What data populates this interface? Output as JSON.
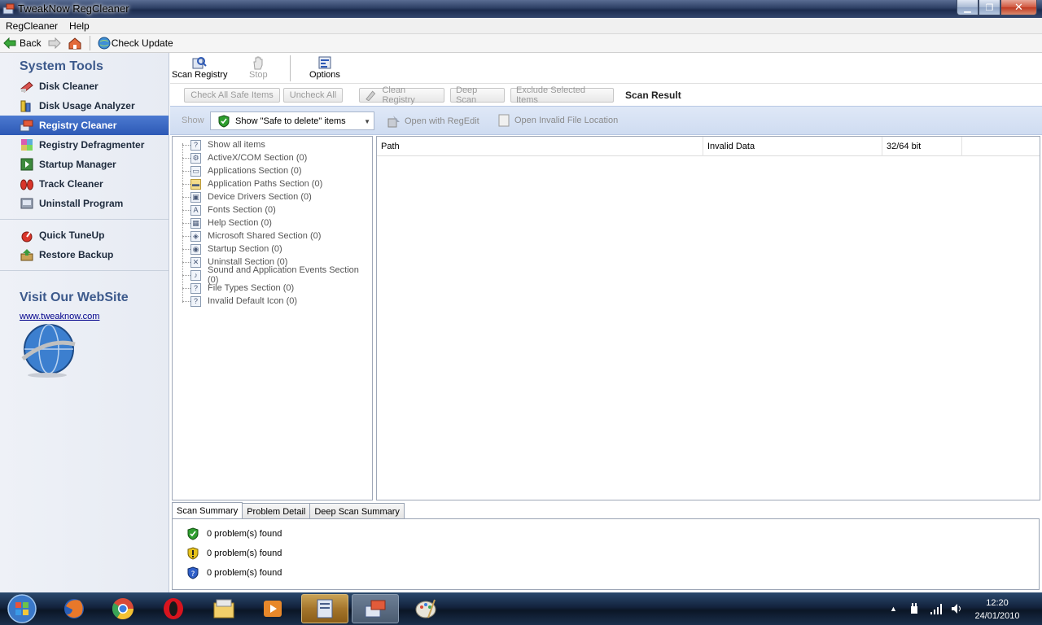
{
  "window": {
    "title": "TweakNow RegCleaner"
  },
  "menu": {
    "items": [
      "RegCleaner",
      "Help"
    ]
  },
  "nav": {
    "back": "Back",
    "check_update": "Check Update"
  },
  "sidebar": {
    "system_tools_title": "System Tools",
    "items": [
      {
        "label": "Disk Cleaner",
        "icon": "disk-cleaner-icon"
      },
      {
        "label": "Disk Usage Analyzer",
        "icon": "disk-usage-icon"
      },
      {
        "label": "Registry Cleaner",
        "icon": "registry-cleaner-icon",
        "active": true
      },
      {
        "label": "Registry Defragmenter",
        "icon": "registry-defrag-icon"
      },
      {
        "label": "Startup Manager",
        "icon": "startup-manager-icon"
      },
      {
        "label": "Track Cleaner",
        "icon": "track-cleaner-icon"
      },
      {
        "label": "Uninstall Program",
        "icon": "uninstall-icon"
      }
    ],
    "extra_items": [
      {
        "label": "Quick TuneUp",
        "icon": "quick-tuneup-icon"
      },
      {
        "label": "Restore Backup",
        "icon": "restore-backup-icon"
      }
    ],
    "visit_title": "Visit Our WebSite",
    "website": "www.tweaknow.com"
  },
  "toolbar": {
    "scan": "Scan Registry",
    "stop": "Stop",
    "options": "Options"
  },
  "actions": {
    "check_all": "Check All Safe Items",
    "uncheck_all": "Uncheck All",
    "clean": "Clean Registry",
    "deep_scan": "Deep Scan",
    "exclude": "Exclude Selected Items",
    "scan_result": "Scan Result"
  },
  "filter": {
    "show_label": "Show",
    "selected": "Show \"Safe to delete\" items",
    "open_regedit": "Open with RegEdit",
    "open_location": "Open Invalid File Location"
  },
  "tree": {
    "items": [
      "Show all items",
      "ActiveX/COM Section (0)",
      "Applications Section (0)",
      "Application Paths Section (0)",
      "Device Drivers Section (0)",
      "Fonts Section (0)",
      "Help Section (0)",
      "Microsoft Shared Section (0)",
      "Startup Section (0)",
      "Uninstall Section (0)",
      "Sound and Application Events Section (0)",
      "File Types Section (0)",
      "Invalid Default Icon (0)"
    ]
  },
  "results": {
    "columns": [
      "Path",
      "Invalid Data",
      "32/64 bit"
    ]
  },
  "tabs": [
    "Scan Summary",
    "Problem Detail",
    "Deep Scan Summary"
  ],
  "summary": {
    "rows": [
      {
        "text": "0 problem(s) found",
        "color": "#2e9e2e"
      },
      {
        "text": "0 problem(s) found",
        "color": "#e6c21a"
      },
      {
        "text": "0 problem(s) found",
        "color": "#2f5fc9"
      }
    ]
  },
  "clock": {
    "time": "12:20",
    "date": "24/01/2010"
  }
}
